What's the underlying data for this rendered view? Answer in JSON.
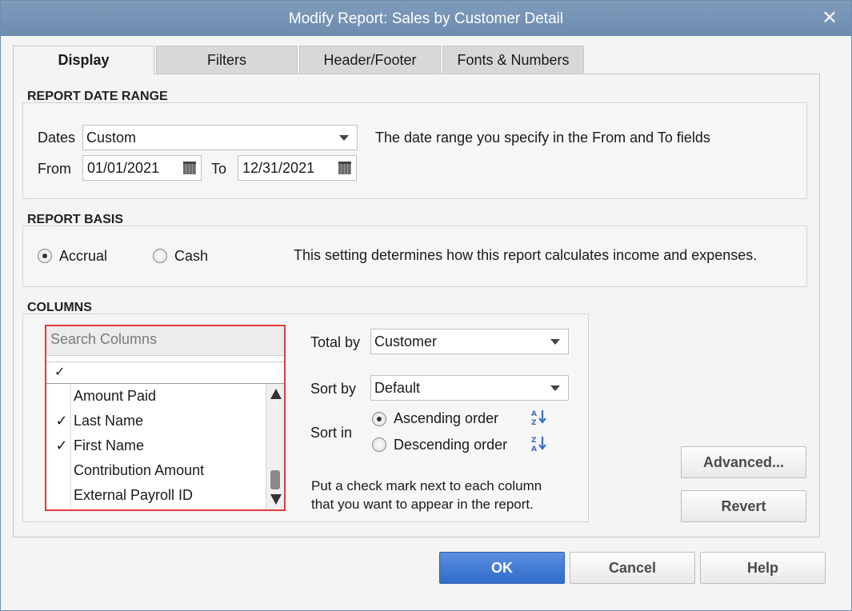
{
  "window": {
    "title": "Modify Report: Sales by Customer Detail",
    "close_glyph": "✕"
  },
  "tabs": [
    {
      "label": "Display",
      "key": "D",
      "active": true
    },
    {
      "label": "Filters",
      "key": "F",
      "active": false
    },
    {
      "label": "Header/Footer",
      "key": "H",
      "active": false
    },
    {
      "label": "Fonts & Numbers",
      "key": "N",
      "active": false
    }
  ],
  "date_range": {
    "title": "REPORT DATE RANGE",
    "dates_label": "Dates",
    "dates_value": "Custom",
    "hint": "The date range you specify in the From and To fields",
    "from_label": "From",
    "from_value": "01/01/2021",
    "to_label": "To",
    "to_value": "12/31/2021"
  },
  "basis": {
    "title": "REPORT BASIS",
    "accrual_label": "Accrual",
    "cash_label": "Cash",
    "selected": "accrual",
    "hint": "This setting determines how this report calculates income and expenses."
  },
  "columns": {
    "title": "COLUMNS",
    "search_placeholder": "Search Columns",
    "header_check": "✓",
    "items": [
      {
        "name": "Amount Paid",
        "checked": false
      },
      {
        "name": "Last Name",
        "checked": true
      },
      {
        "name": "First Name",
        "checked": true
      },
      {
        "name": "Contribution Amount",
        "checked": false
      },
      {
        "name": "External Payroll ID",
        "checked": false
      }
    ],
    "check_glyph": "✓",
    "total_by_label": "Total by",
    "total_by_value": "Customer",
    "sort_by_label": "Sort by",
    "sort_by_value": "Default",
    "sort_in_label": "Sort in",
    "ascending_label": "Ascending order",
    "descending_label": "Descending order",
    "sort_selected": "ascending",
    "instruction_line1": "Put a check mark next to each column",
    "instruction_line2": "that you want to appear in the report."
  },
  "buttons": {
    "advanced": "Advanced...",
    "revert": "Revert",
    "ok": "OK",
    "cancel": "Cancel",
    "help": "Help"
  },
  "icons": {
    "calendar": "calendar-icon",
    "sort_asc": "sort-ascending-icon",
    "sort_desc": "sort-descending-icon"
  }
}
